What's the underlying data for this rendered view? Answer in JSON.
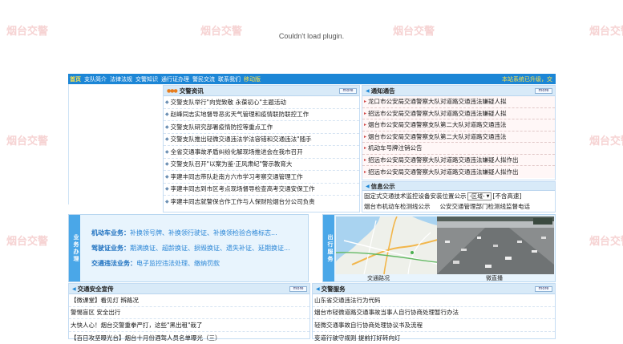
{
  "watermark": "烟台交警",
  "plugin_message": "Couldn't load plugin.",
  "nav": {
    "items": [
      "首页",
      "支队简介",
      "法律法规",
      "交警知识",
      "通行证办理",
      "警民交流",
      "联系我们",
      "移动版"
    ],
    "status": "本站系统已升级，交"
  },
  "traffic_news": {
    "title": "交警资讯",
    "more": "more",
    "items": [
      "交警支队举行\"向党致敬 永葆初心\"主题活动",
      "赵峰同志实地督导恶劣天气管理和疫情联防联控工作",
      "交警支队研究部署疫情防控等重点工作",
      "交警支队推出轻微交通违法学法容错和交通违法\"随手",
      "全省交通事故矛盾纠纷化解现场推进会在我市召开",
      "交警支队召开\"以案为鉴·正风肃纪\"警示教育大",
      "李建丰同志带队赴南方六市学习考察交通管理工作",
      "李建丰同志到市区考点现场督导检查高考交通安保工作",
      "李建丰同志就警保合作工作与人保财险烟台分公司负责"
    ]
  },
  "notice": {
    "title": "通知通告",
    "more": "more",
    "items": [
      "龙口市公安局交通警察大队对道路交通违法嫌疑人拟",
      "招远市公安局交通警察大队对道路交通违法嫌疑人拟",
      "烟台市公安局交通警察支队第二大队对道路交通违法",
      "烟台市公安局交通警察支队第二大队对道路交通违法",
      "机动车号牌注销公告",
      "招远市公安局交通警察大队对道路交通违法嫌疑人拟作出",
      "招远市公安局交通警察大队对道路交通违法嫌疑人拟作出"
    ]
  },
  "info": {
    "title": "信息公示",
    "line1_prefix": "固定式交通技术监控设备安装位置公示",
    "select_value": "-区域-",
    "line1_suffix": "[不含高速]",
    "line2_a": "烟台市机动车检测线公示",
    "line2_b": "公安交通管理部门检测线监督电话"
  },
  "business": {
    "tab": "业务办理",
    "lines": [
      {
        "key": "机动车业务：",
        "value": "补换领号牌、补换领行驶证、补换领检验合格标志..."
      },
      {
        "key": "驾驶证业务：",
        "value": "期满换证、超龄换证、损毁换证、遗失补证、延期换证..."
      },
      {
        "key": "交通违法业务：",
        "value": "电子监控违法处理、缴纳罚款"
      }
    ]
  },
  "travel": {
    "tab": "出行服务",
    "captions": [
      "交通路况",
      "微直播"
    ]
  },
  "safety": {
    "title": "交通安全宣传",
    "more": "more",
    "items": [
      "【微课堂】看见灯 辨路况",
      "警惕盲区 安全出行",
      "大快人心！烟台交警重拳严打，这些\"黑出租\"栽了",
      "【百日攻坚曝光台】烟台十月份酒驾人员名单曝光（三）"
    ]
  },
  "traffic_service": {
    "title": "交警服务",
    "more": "more",
    "items": [
      "山东省交通违法行为代码",
      "烟台市轻微道路交通事故当事人自行协商处理暂行办法",
      "轻微交通事故自行协商处理协议书及流程",
      "变道行驶守规则 提前打好转向灯"
    ]
  }
}
